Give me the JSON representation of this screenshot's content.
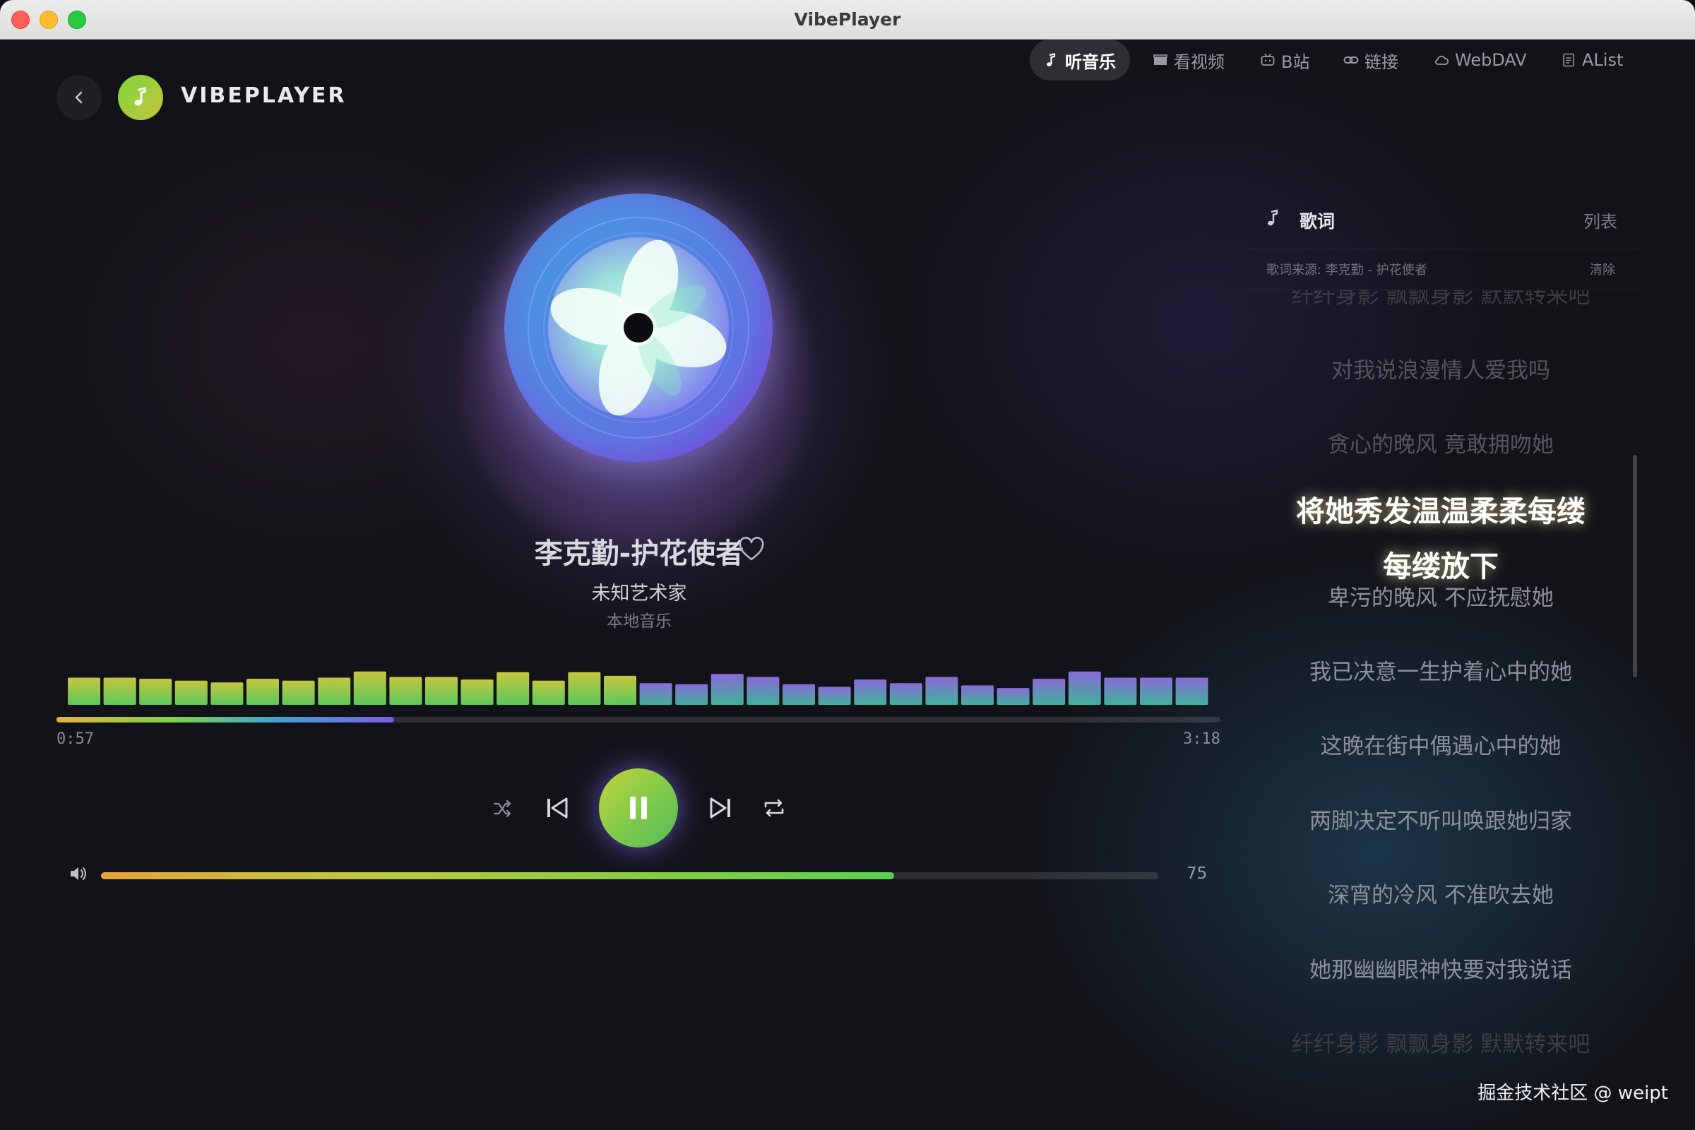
{
  "window": {
    "title": "VibePlayer"
  },
  "header": {
    "back_icon": "chevron-left-icon",
    "logo_icon": "music-note-icon",
    "brand": "VIBEPLAYER",
    "tabs": [
      {
        "label": "听音乐",
        "icon": "music-note-icon",
        "active": true
      },
      {
        "label": "看视频",
        "icon": "clapperboard-icon",
        "active": false
      },
      {
        "label": "B站",
        "icon": "tv-icon",
        "active": false
      },
      {
        "label": "链接",
        "icon": "link-icon",
        "active": false
      },
      {
        "label": "WebDAV",
        "icon": "cloud-icon",
        "active": false
      },
      {
        "label": "AList",
        "icon": "list-icon",
        "active": false
      }
    ]
  },
  "player": {
    "title": "李克勤-护花使者",
    "artist": "未知艺术家",
    "source": "本地音乐",
    "current_time": "0:57",
    "total_time": "3:18",
    "progress": 0.29,
    "playing": true,
    "volume": "75",
    "volume_level": 0.75,
    "spectrum_levels": [
      0.74,
      0.74,
      0.71,
      0.66,
      0.61,
      0.71,
      0.66,
      0.74,
      0.91,
      0.76,
      0.76,
      0.69,
      0.89,
      0.66,
      0.89,
      0.79,
      0.59,
      0.56,
      0.84,
      0.76,
      0.56,
      0.49,
      0.69,
      0.59,
      0.76,
      0.53,
      0.46,
      0.71,
      0.91,
      0.74,
      0.74,
      0.74
    ],
    "accent_colors": {
      "green": "#7cd24a",
      "purple": "#7a5be6",
      "gold": "#e6b23a"
    }
  },
  "lyrics": {
    "tab_label": "歌词",
    "list_label": "列表",
    "source_text": "歌词来源: 李克勤 - 护花使者",
    "clear_label": "清除",
    "lines": [
      {
        "text": "纤纤身影 飘飘身影 默默转来吧",
        "state": "faint"
      },
      {
        "text": "对我说浪漫情人爱我吗",
        "state": "fade"
      },
      {
        "text": "贪心的晚风 竟敢拥吻她",
        "state": "fade"
      },
      {
        "text": "将她秀发温温柔柔每缕每缕放下",
        "state": "current"
      },
      {
        "text": "卑污的晚风 不应抚慰她",
        "state": "normal"
      },
      {
        "text": "我已决意一生护着心中的她",
        "state": "normal"
      },
      {
        "text": "这晚在街中偶遇心中的她",
        "state": "normal"
      },
      {
        "text": "两脚决定不听叫唤跟她归家",
        "state": "normal"
      },
      {
        "text": "深宵的冷风 不准吹去她",
        "state": "normal"
      },
      {
        "text": "她那幽幽眼神快要对我说话",
        "state": "normal"
      },
      {
        "text": "纤纤身影 飘飘身影 默默转来吧",
        "state": "faint"
      }
    ]
  },
  "watermark": "掘金技术社区 @ weipt"
}
